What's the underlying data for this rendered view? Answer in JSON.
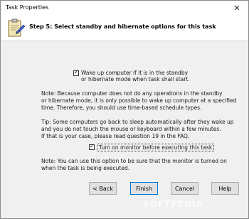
{
  "window": {
    "title": "Task Properties",
    "close_glyph": "✕"
  },
  "header": {
    "step_title": "Step 5: Select standby and hibernate options for this task",
    "icon": "task-clipboard-icon"
  },
  "options": {
    "wake_up": {
      "checked": true,
      "label_line1": "Wake up computer if it is in the standby",
      "label_line2": "or hibernate mode when task shall start."
    },
    "turn_on_monitor": {
      "checked": true,
      "label": "Turn on monitor before executing this task"
    }
  },
  "notes": {
    "note1": "Note: Because computer does not do any operations in the standby\nor hibernate mode, it is only possible to wake up computer at a specified\ntime. Therefore, you should use time-based schedule types.",
    "tip": "Tip: Some computers go back to sleep automatically after they wake up\nand you do not touch the mouse or keyboard within a few minutes.\nIf that is your case, please read question 19 in the FAQ.",
    "note2": "Note: You can use this option to be sure that the monitor is turned on\nwhen the task is being executed."
  },
  "buttons": {
    "back": "< Back",
    "finish": "Finish",
    "cancel": "Cancel",
    "help": "Help"
  },
  "watermark": "SOFTPEDIA",
  "colors": {
    "content_bg": "#f0f0f0",
    "header_bg": "#ffffff",
    "button_bg": "#e1e1e1",
    "default_button_border": "#0078d7"
  }
}
